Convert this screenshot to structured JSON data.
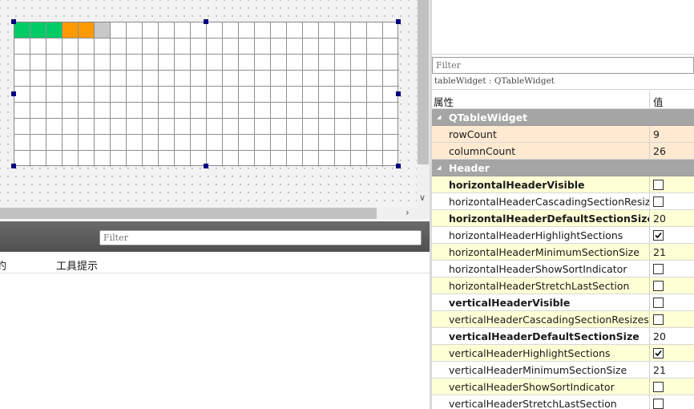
{
  "designer": {
    "table_rows": 9,
    "table_cols": 24,
    "colored_cells": [
      {
        "row": 0,
        "col": 0,
        "color": "#00cc66"
      },
      {
        "row": 0,
        "col": 1,
        "color": "#00cc66"
      },
      {
        "row": 0,
        "col": 2,
        "color": "#00cc66"
      },
      {
        "row": 0,
        "col": 3,
        "color": "#ff9900"
      },
      {
        "row": 0,
        "col": 4,
        "color": "#ff9900"
      },
      {
        "row": 0,
        "col": 5,
        "color": "#c8c8c8"
      }
    ],
    "selection_color": "#00007f"
  },
  "scroll": {
    "vertical_arrow": "∨",
    "horizontal_arrow": "›"
  },
  "action_editor": {
    "filter_placeholder": "Filter",
    "columns": [
      "钓",
      "工具提示"
    ]
  },
  "property_editor": {
    "filter_placeholder": "Filter",
    "object_label": "tableWidget : QTableWidget",
    "header": {
      "property": "属性",
      "value": "值"
    },
    "rows": [
      {
        "kind": "group",
        "name": "QTableWidget"
      },
      {
        "kind": "prop",
        "tint": "orange",
        "name": "rowCount",
        "bold": false,
        "value": "9"
      },
      {
        "kind": "prop",
        "tint": "orange",
        "name": "columnCount",
        "bold": false,
        "value": "26"
      },
      {
        "kind": "group",
        "name": "Header"
      },
      {
        "kind": "prop",
        "tint": "yellow",
        "name": "horizontalHeaderVisible",
        "bold": true,
        "checkbox": false
      },
      {
        "kind": "prop",
        "tint": "white",
        "name": "horizontalHeaderCascadingSectionResizes",
        "bold": false,
        "checkbox": false
      },
      {
        "kind": "prop",
        "tint": "yellow",
        "name": "horizontalHeaderDefaultSectionSize",
        "bold": true,
        "value": "20"
      },
      {
        "kind": "prop",
        "tint": "white",
        "name": "horizontalHeaderHighlightSections",
        "bold": false,
        "checkbox": true
      },
      {
        "kind": "prop",
        "tint": "yellow",
        "name": "horizontalHeaderMinimumSectionSize",
        "bold": false,
        "value": "21"
      },
      {
        "kind": "prop",
        "tint": "white",
        "name": "horizontalHeaderShowSortIndicator",
        "bold": false,
        "checkbox": false
      },
      {
        "kind": "prop",
        "tint": "yellow",
        "name": "horizontalHeaderStretchLastSection",
        "bold": false,
        "checkbox": false
      },
      {
        "kind": "prop",
        "tint": "white",
        "name": "verticalHeaderVisible",
        "bold": true,
        "checkbox": false
      },
      {
        "kind": "prop",
        "tint": "yellow",
        "name": "verticalHeaderCascadingSectionResizes",
        "bold": false,
        "checkbox": false
      },
      {
        "kind": "prop",
        "tint": "white",
        "name": "verticalHeaderDefaultSectionSize",
        "bold": true,
        "value": "20"
      },
      {
        "kind": "prop",
        "tint": "yellow",
        "name": "verticalHeaderHighlightSections",
        "bold": false,
        "checkbox": true
      },
      {
        "kind": "prop",
        "tint": "white",
        "name": "verticalHeaderMinimumSectionSize",
        "bold": false,
        "value": "21"
      },
      {
        "kind": "prop",
        "tint": "yellow",
        "name": "verticalHeaderShowSortIndicator",
        "bold": false,
        "checkbox": false
      },
      {
        "kind": "prop",
        "tint": "white",
        "name": "verticalHeaderStretchLastSection",
        "bold": false,
        "checkbox": false
      }
    ]
  }
}
